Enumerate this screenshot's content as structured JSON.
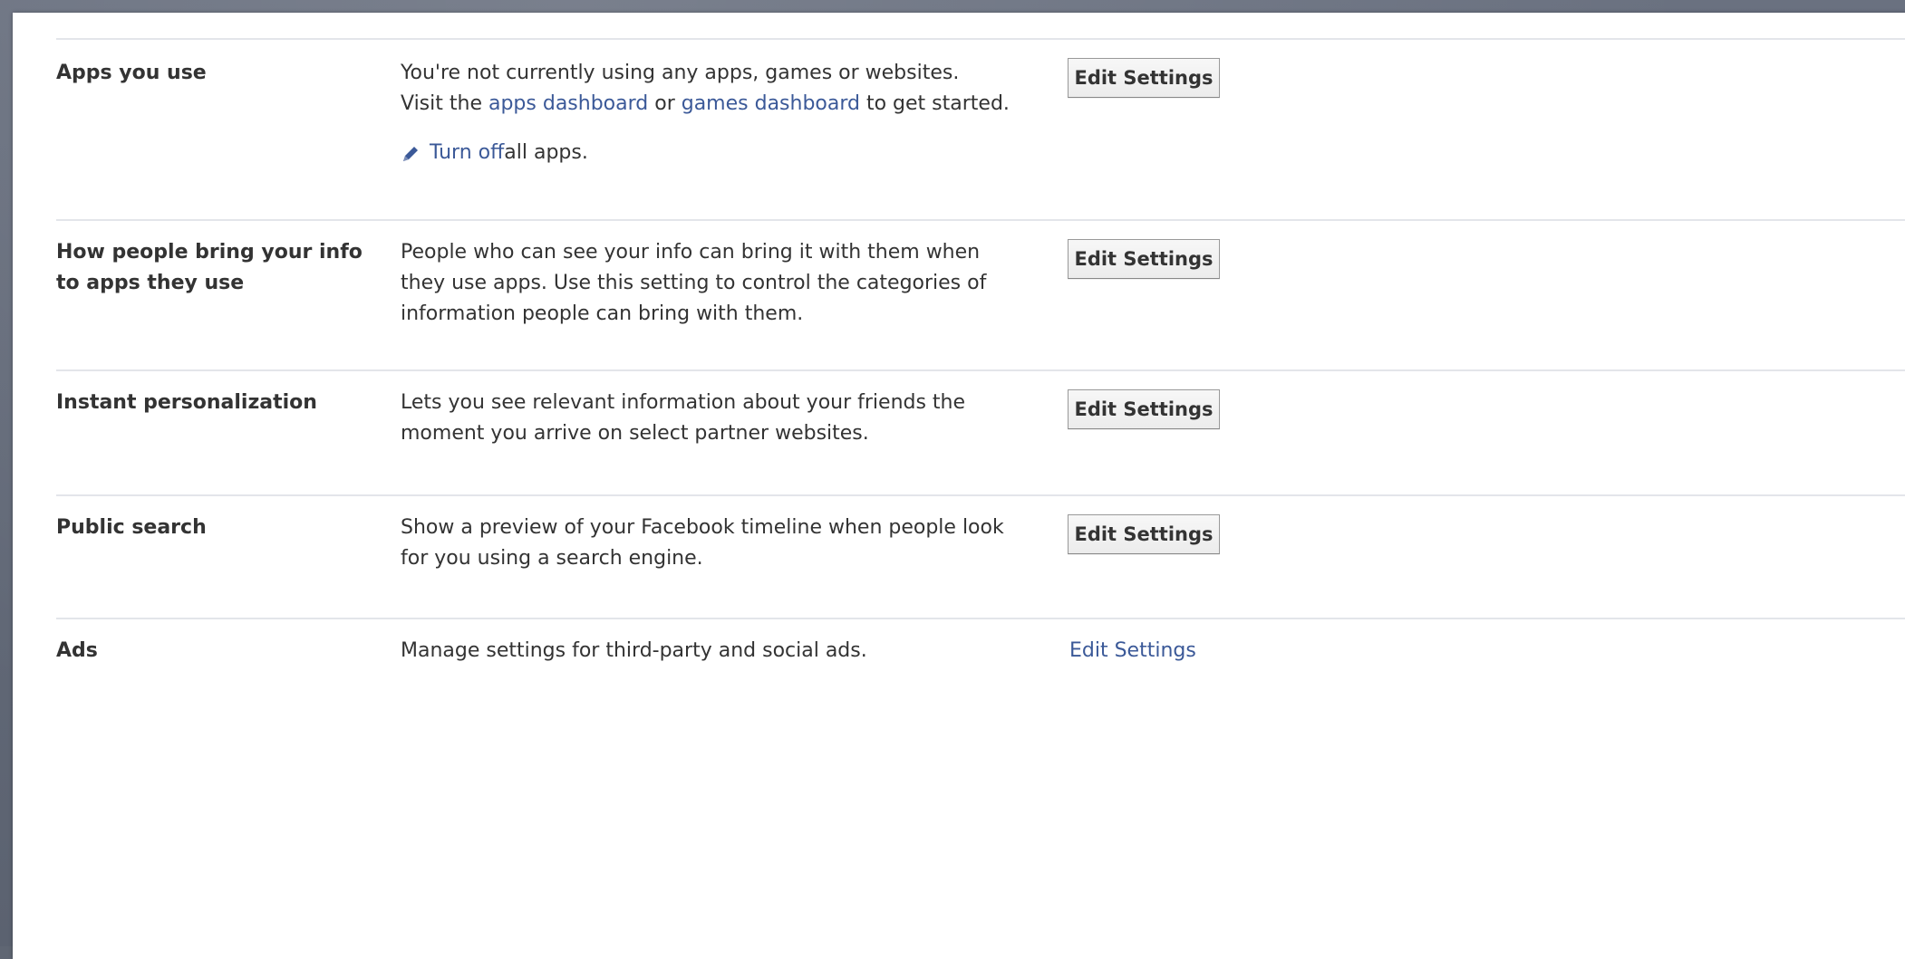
{
  "settings": {
    "rows": [
      {
        "label": "Apps you use",
        "description_line1": "You're not currently using any apps, games or websites.",
        "description_line2_prefix": "Visit the ",
        "apps_dashboard_link": "apps dashboard",
        "description_line2_middle": " or ",
        "games_dashboard_link": "games dashboard",
        "description_line2_suffix": " to get started.",
        "turn_off_link": "Turn off",
        "turn_off_suffix": " all apps.",
        "action_label": "Edit Settings"
      },
      {
        "label_line1": "How people bring your info",
        "label_line2": "to apps they use",
        "description_line1": "People who can see your info can bring it with them when",
        "description_line2": "they use apps. Use this setting to control the categories of",
        "description_line3": "information people can bring with them.",
        "action_label": "Edit Settings"
      },
      {
        "label": "Instant personalization",
        "description_line1": "Lets you see relevant information about your friends the",
        "description_line2": "moment you arrive on select partner websites.",
        "action_label": "Edit Settings"
      },
      {
        "label": "Public search",
        "description_line1": "Show a preview of your Facebook timeline when people look",
        "description_line2": "for you using a search engine.",
        "action_label": "Edit Settings"
      },
      {
        "label": "Ads",
        "description_line1": "Manage settings for third-party and social ads.",
        "action_label": "Edit Settings"
      }
    ]
  },
  "colors": {
    "link": "#3b5998",
    "text": "#333333",
    "divider": "#e3e5ea",
    "backdrop": "#5f6673"
  },
  "icons": {
    "turn_off": "pencil-icon"
  }
}
